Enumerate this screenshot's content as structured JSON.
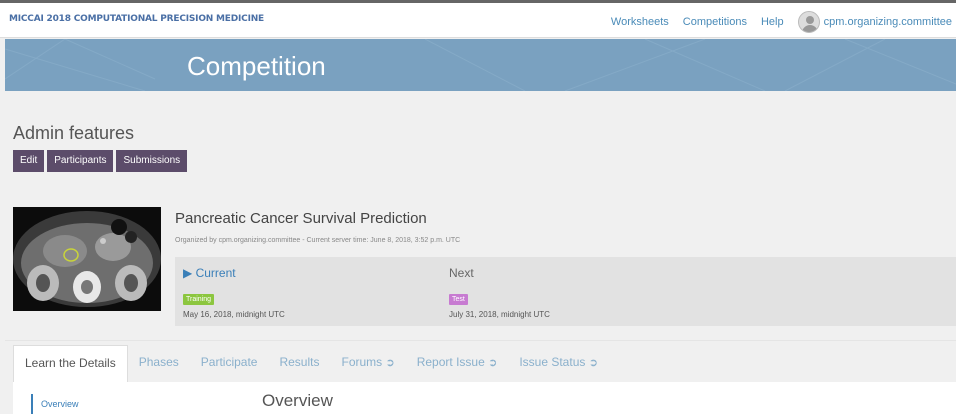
{
  "topbar": {
    "brand": "MICCAI 2018 COMPUTATIONAL PRECISION MEDICINE",
    "nav": [
      "Worksheets",
      "Competitions",
      "Help"
    ],
    "user": "cpm.organizing.committee"
  },
  "banner": {
    "title": "Competition"
  },
  "admin": {
    "title": "Admin features",
    "buttons": [
      "Edit",
      "Participants",
      "Submissions"
    ]
  },
  "competition": {
    "name": "Pancreatic Cancer Survival Prediction",
    "meta": "Organized by cpm.organizing.committee - Current server time: June 8, 2018, 3:52 p.m. UTC",
    "current": {
      "heading": "▶ Current",
      "badge": "Training",
      "date": "May 16, 2018, midnight UTC"
    },
    "next": {
      "heading": "Next",
      "badge": "Test",
      "date": "July 31, 2018, midnight UTC"
    }
  },
  "tabs": [
    {
      "label": "Learn the Details"
    },
    {
      "label": "Phases"
    },
    {
      "label": "Participate"
    },
    {
      "label": "Results"
    },
    {
      "label": "Forums"
    },
    {
      "label": "Report Issue"
    },
    {
      "label": "Issue Status"
    }
  ],
  "details": {
    "sidebar_item": "Overview",
    "heading": "Overview"
  },
  "colors": {
    "banner": "#7aa1c0",
    "admin_button": "#5c4c6a",
    "link": "#4a8bb8",
    "training_badge": "#8cc63f",
    "test_badge": "#c77bd1"
  }
}
